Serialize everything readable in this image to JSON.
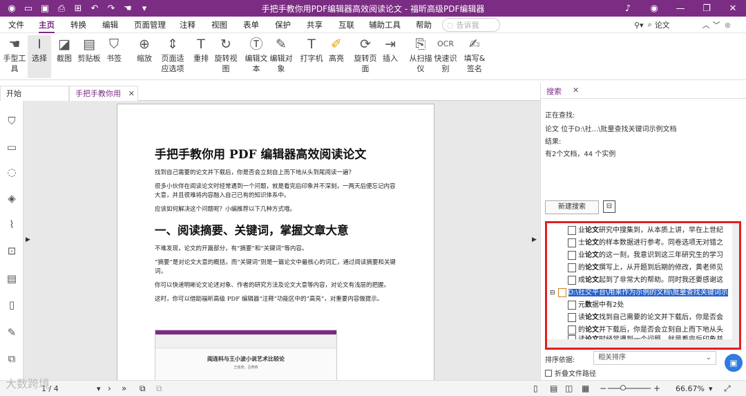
{
  "window": {
    "title": "手把手教你用PDF编辑器高效阅读论文 - 福昕高级PDF编辑器"
  },
  "menu": {
    "items": [
      "文件",
      "主页",
      "转换",
      "编辑",
      "页面管理",
      "注释",
      "视图",
      "表单",
      "保护",
      "共享",
      "互联",
      "辅助工具",
      "帮助"
    ],
    "search_placeholder": "告诉我",
    "find_value": "论文"
  },
  "ribbon": {
    "buttons": [
      {
        "icon": "hand",
        "label": "手型工具"
      },
      {
        "icon": "cursor",
        "label": "选择"
      },
      {
        "icon": "crop",
        "label": "截图"
      },
      {
        "icon": "clipboard",
        "label": "剪贴板"
      },
      {
        "icon": "bookmark",
        "label": "书签"
      },
      {
        "icon": "zoom",
        "label": "缩放"
      },
      {
        "icon": "fit",
        "label": "页面适应选项"
      },
      {
        "icon": "reflow",
        "label": "重排"
      },
      {
        "icon": "rotate",
        "label": "旋转视图"
      },
      {
        "icon": "edit-text",
        "label": "编辑文本"
      },
      {
        "icon": "edit-obj",
        "label": "编辑对象"
      },
      {
        "icon": "typewriter",
        "label": "打字机"
      },
      {
        "icon": "highlight",
        "label": "高亮"
      },
      {
        "icon": "rotate-page",
        "label": "旋转页面"
      },
      {
        "icon": "insert",
        "label": "插入"
      },
      {
        "icon": "scan",
        "label": "从扫描仪"
      },
      {
        "icon": "ocr",
        "label": "快速识别"
      },
      {
        "icon": "sign",
        "label": "填写&签名"
      }
    ]
  },
  "tabs": {
    "start": "开始",
    "doc": "手把手教你用PDF..."
  },
  "doc": {
    "title": "手把手教你用 PDF 编辑器高效阅读论文",
    "p1": "找到自己需要的论文并下载后，你是否会立刻自上而下地从头到尾阅读一遍？",
    "p2": "很多小伙伴在阅读论文时经常遇到一个问题，就是看完后印象并不深刻，一两天后便忘记内容大意，并且很难将内容融入自己已有的知识体系中。",
    "p3": "应该如何解决这个问题呢？小编推荐以下几种方式哦。",
    "h2": "一、阅读摘要、关键词，掌握文章大意",
    "p4": "不难发现，论文的开篇部分，有“摘要”和“关键词”等内容。",
    "p5": "“摘要”是对论文大意的概括，而“关键词”则是一篇论文中最核心的词汇，通过阅读摘要和关键词，",
    "p6": "你可以快速明晰论文论述对象、作者的研究方法及论文大意等内容，对论文有浅层的把握。",
    "p7": "这时，你可以借助福昕高级 PDF 编辑器“注释”功能区中的“高亮”，对重要内容做提示。",
    "thumb_title": "阎连科与王小波小说艺术比较论",
    "thumb_sub": "王俊虎，吕燕燕"
  },
  "search": {
    "tab": "搜索",
    "searching": "正在查找:",
    "query": "论文 位于D:\\社...\\批量查找关键词示例文档",
    "result_label": "结果:",
    "result": "有2个文档，44 个实例",
    "new_search": "新建搜索",
    "rows": [
      {
        "pre": "业",
        "kw": "论文",
        "post": "研究中搜集到，从本质上讲，早在上世纪"
      },
      {
        "pre": "士",
        "kw": "论文",
        "post": "的样本数据进行参考。同卷选项无对错之"
      },
      {
        "pre": "业",
        "kw": "论文",
        "post": "的这一刻，我意识到这三年研究生的学习"
      },
      {
        "pre": "的",
        "kw": "论文",
        "post": "撰写上，从开题到后期的修改，黄老师见"
      },
      {
        "pre": "成",
        "kw": "论文",
        "post": "起到了非常大的帮助。同时我还要感谢这"
      },
      {
        "pre": "",
        "kw": "",
        "post": "D:\\社交平台\\用来作为示例的文档\\批量查找关键词示"
      },
      {
        "pre": "元",
        "kw": "数",
        "post": "据中有2处"
      },
      {
        "pre": "读",
        "kw": "论文",
        "post": "找到自己需要的论文并下载后，你是否会"
      },
      {
        "pre": "的",
        "kw": "论文",
        "post": "并下载后，你是否会立刻自上而下地从头"
      },
      {
        "pre": "读",
        "kw": "论文",
        "post": "时经常遇到一个问题，就是看完后印象并"
      }
    ],
    "sort_label": "排序依据:",
    "sort_value": "相关排序",
    "collapse_label": "折叠文件路径"
  },
  "status": {
    "page": "1 / 4",
    "zoom": "66.67%"
  },
  "watermark": "大数跨境"
}
